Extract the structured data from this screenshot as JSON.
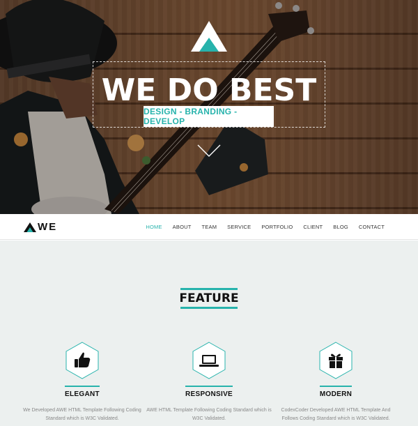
{
  "hero": {
    "title": "WE DO BEST",
    "subtitle": "DESIGN - BRANDING - DEVELOP"
  },
  "navbar": {
    "brand": "WE",
    "items": [
      {
        "label": "HOME",
        "active": true
      },
      {
        "label": "ABOUT"
      },
      {
        "label": "TEAM"
      },
      {
        "label": "SERVICE"
      },
      {
        "label": "PORTFOLIO"
      },
      {
        "label": "CLIENT"
      },
      {
        "label": "BLOG"
      },
      {
        "label": "CONTACT"
      }
    ]
  },
  "feature": {
    "heading": "FEATURE",
    "columns": [
      {
        "icon": "thumbs-up-icon",
        "title": "ELEGANT",
        "desc": "We Developed AWE HTML Template Following Coding Standard which is W3C Validated."
      },
      {
        "icon": "laptop-icon",
        "title": "RESPONSIVE",
        "desc": "AWE HTML Template Following Coding Standard which is W3C Validated."
      },
      {
        "icon": "gift-icon",
        "title": "MODERN",
        "desc": "CodexCoder Developed AWE HTML Template And Follows Coding Standard which is W3C Validated."
      }
    ]
  },
  "colors": {
    "accent": "#27b3ac",
    "feature_bg": "#ecf0ef",
    "text_dark": "#111111",
    "text_muted": "#888888"
  }
}
